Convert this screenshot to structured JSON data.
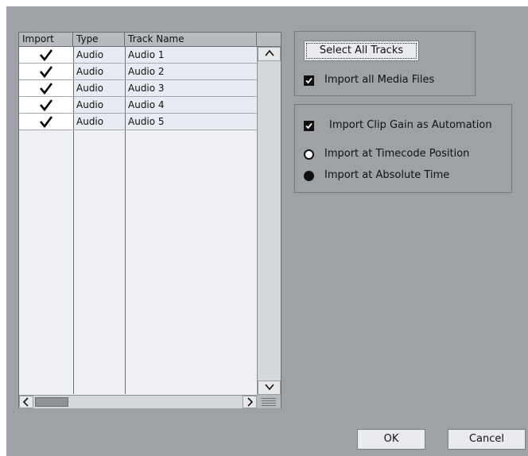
{
  "table": {
    "headers": [
      "Import",
      "Type",
      "Track Name"
    ],
    "rows": [
      {
        "import": true,
        "type": "Audio",
        "name": "Audio 1"
      },
      {
        "import": true,
        "type": "Audio",
        "name": "Audio 2"
      },
      {
        "import": true,
        "type": "Audio",
        "name": "Audio 3"
      },
      {
        "import": true,
        "type": "Audio",
        "name": "Audio 4"
      },
      {
        "import": true,
        "type": "Audio",
        "name": "Audio 5"
      }
    ]
  },
  "group1": {
    "select_all_label": "Select All Tracks",
    "import_media_label": "Import all Media Files",
    "import_media_checked": true
  },
  "group2": {
    "clip_gain_label": "Import Clip Gain as Automation",
    "clip_gain_checked": true,
    "timecode_label": "Import at Timecode Position",
    "timecode_selected": false,
    "absolute_label": "Import at Absolute Time",
    "absolute_selected": true
  },
  "footer": {
    "ok_label": "OK",
    "cancel_label": "Cancel"
  },
  "icons": {
    "check": "check-icon",
    "scroll_up": "chevron-up-icon",
    "scroll_down": "chevron-down-icon",
    "scroll_left": "chevron-left-icon",
    "scroll_right": "chevron-right-icon"
  }
}
